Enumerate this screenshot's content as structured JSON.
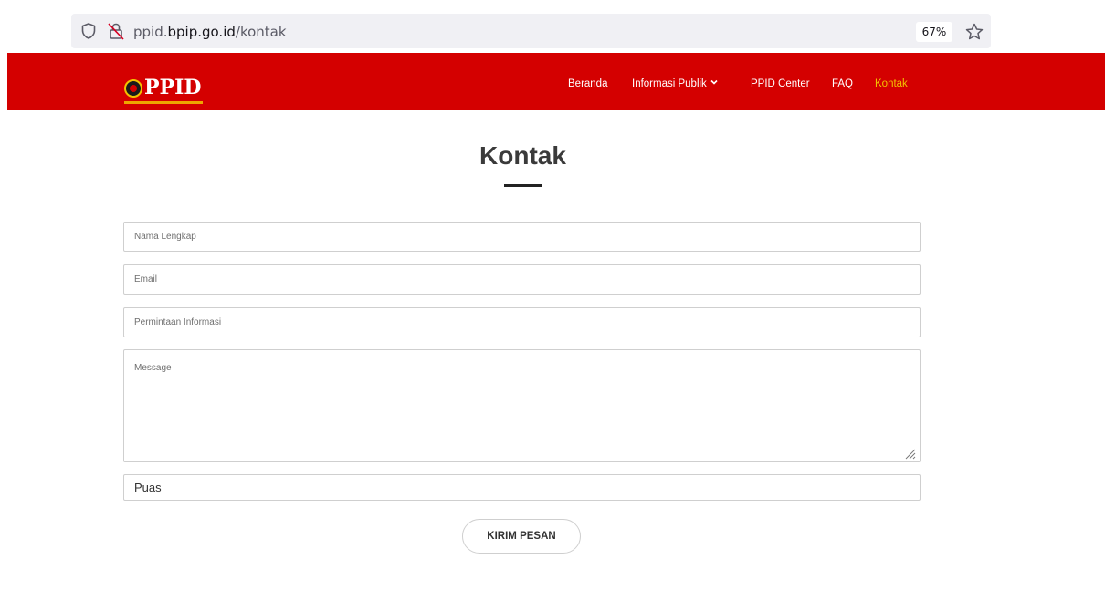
{
  "browser": {
    "url_prefix": "ppid.",
    "url_domain": "bpip.go.id",
    "url_path": "/kontak",
    "zoom": "67%",
    "icons": [
      "shield-icon",
      "lock-icon",
      "star-icon"
    ]
  },
  "header": {
    "logo_text": "PPID",
    "background_color": "#d40000",
    "active_color": "#f2c200",
    "nav": {
      "beranda": "Beranda",
      "informasi_publik": "Informasi Publik",
      "ppid_center": "PPID Center",
      "faq": "FAQ",
      "kontak": "Kontak"
    },
    "active_item": "Kontak"
  },
  "main": {
    "title": "Kontak"
  },
  "form": {
    "nama_placeholder": "Nama Lengkap",
    "email_placeholder": "Email",
    "permintaan_placeholder": "Permintaan Informasi",
    "message_placeholder": "Message",
    "selected_option": "Puas",
    "submit_label": "KIRIM PESAN"
  }
}
